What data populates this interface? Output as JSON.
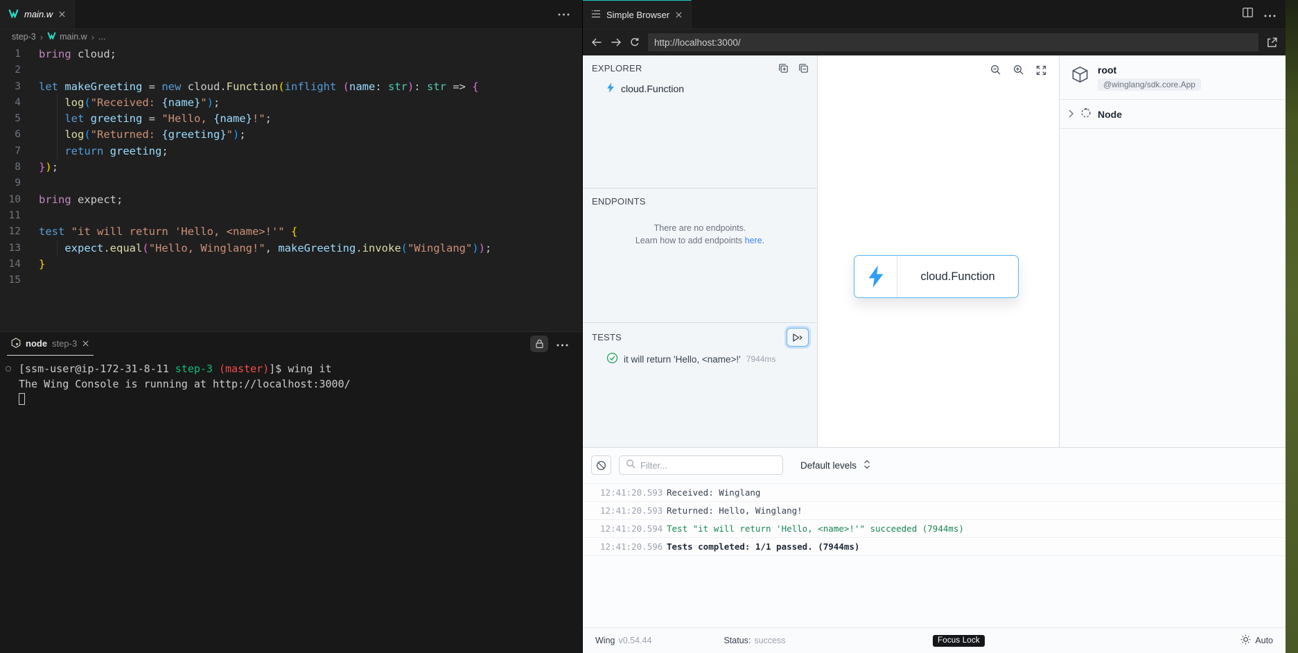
{
  "colors": {
    "wing_teal": "#2bd9c7",
    "accent_blue": "#2f9ff5",
    "success_green": "#22a75d",
    "link_blue": "#3b82f6"
  },
  "editor": {
    "tab_title": "main.w",
    "breadcrumb": {
      "folder": "step-3",
      "file": "main.w",
      "more": "..."
    },
    "code_lines": [
      {
        "n": "1",
        "segs": [
          [
            "imp",
            "bring"
          ],
          [
            "d",
            " cloud;"
          ]
        ]
      },
      {
        "n": "2",
        "segs": []
      },
      {
        "n": "3",
        "segs": [
          [
            "kw",
            "let"
          ],
          [
            "d",
            " "
          ],
          [
            "var",
            "makeGreeting"
          ],
          [
            "d",
            " = "
          ],
          [
            "kw",
            "new"
          ],
          [
            "d",
            " cloud."
          ],
          [
            "fn",
            "Function"
          ],
          [
            "b1",
            "("
          ],
          [
            "kw",
            "inflight"
          ],
          [
            "d",
            " "
          ],
          [
            "b2",
            "("
          ],
          [
            "var",
            "name"
          ],
          [
            "d",
            ": "
          ],
          [
            "type",
            "str"
          ],
          [
            "b2",
            ")"
          ],
          [
            "d",
            ": "
          ],
          [
            "type",
            "str"
          ],
          [
            "d",
            " => "
          ],
          [
            "b2",
            "{"
          ]
        ]
      },
      {
        "n": "4",
        "guide": true,
        "segs": [
          [
            "d",
            "    "
          ],
          [
            "fn",
            "log"
          ],
          [
            "b3",
            "("
          ],
          [
            "str",
            "\"Received: "
          ],
          [
            "var",
            "{name}"
          ],
          [
            "str",
            "\""
          ],
          [
            "b3",
            ")"
          ],
          [
            "d",
            ";"
          ]
        ]
      },
      {
        "n": "5",
        "guide": true,
        "segs": [
          [
            "d",
            "    "
          ],
          [
            "kw",
            "let"
          ],
          [
            "d",
            " "
          ],
          [
            "var",
            "greeting"
          ],
          [
            "d",
            " = "
          ],
          [
            "str",
            "\"Hello, "
          ],
          [
            "var",
            "{name}"
          ],
          [
            "str",
            "!\""
          ],
          [
            "d",
            ";"
          ]
        ]
      },
      {
        "n": "6",
        "guide": true,
        "segs": [
          [
            "d",
            "    "
          ],
          [
            "fn",
            "log"
          ],
          [
            "b3",
            "("
          ],
          [
            "str",
            "\"Returned: "
          ],
          [
            "var",
            "{greeting}"
          ],
          [
            "str",
            "\""
          ],
          [
            "b3",
            ")"
          ],
          [
            "d",
            ";"
          ]
        ]
      },
      {
        "n": "7",
        "guide": true,
        "segs": [
          [
            "d",
            "    "
          ],
          [
            "kw",
            "return"
          ],
          [
            "d",
            " "
          ],
          [
            "var",
            "greeting"
          ],
          [
            "d",
            ";"
          ]
        ]
      },
      {
        "n": "8",
        "segs": [
          [
            "b2",
            "}"
          ],
          [
            "b1",
            ")"
          ],
          [
            "d",
            ";"
          ]
        ]
      },
      {
        "n": "9",
        "segs": []
      },
      {
        "n": "10",
        "segs": [
          [
            "imp",
            "bring"
          ],
          [
            "d",
            " expect;"
          ]
        ]
      },
      {
        "n": "11",
        "segs": []
      },
      {
        "n": "12",
        "segs": [
          [
            "kw",
            "test"
          ],
          [
            "d",
            " "
          ],
          [
            "str",
            "\"it will return 'Hello, <name>!'\""
          ],
          [
            "d",
            " "
          ],
          [
            "b1",
            "{"
          ]
        ]
      },
      {
        "n": "13",
        "guide": true,
        "segs": [
          [
            "d",
            "    "
          ],
          [
            "var",
            "expect"
          ],
          [
            "d",
            "."
          ],
          [
            "fn",
            "equal"
          ],
          [
            "b2",
            "("
          ],
          [
            "str",
            "\"Hello, Winglang!\""
          ],
          [
            "d",
            ", "
          ],
          [
            "var",
            "makeGreeting"
          ],
          [
            "d",
            "."
          ],
          [
            "fn",
            "invoke"
          ],
          [
            "b3",
            "("
          ],
          [
            "str",
            "\"Winglang\""
          ],
          [
            "b3",
            ")"
          ],
          [
            "b2",
            ")"
          ],
          [
            "d",
            ";"
          ]
        ]
      },
      {
        "n": "14",
        "segs": [
          [
            "b1",
            "}"
          ]
        ]
      },
      {
        "n": "15",
        "segs": []
      }
    ]
  },
  "terminal": {
    "tab_name": "node",
    "tab_detail": "step-3",
    "lines": [
      {
        "marker": true,
        "segs": [
          [
            "td",
            "[ssm-user@ip-172-31-8-11 "
          ],
          [
            "tg",
            "step-3"
          ],
          [
            "td",
            " "
          ],
          [
            "tr",
            "(master)"
          ],
          [
            "td",
            "]$ wing it"
          ]
        ]
      },
      {
        "segs": [
          [
            "td",
            "The Wing Console is running at http://localhost:3000/"
          ]
        ]
      },
      {
        "cursor": true,
        "segs": []
      }
    ]
  },
  "browser": {
    "tab_title": "Simple Browser",
    "url": "http://localhost:3000/"
  },
  "console": {
    "explorer": {
      "title": "EXPLORER",
      "item": "cloud.Function"
    },
    "endpoints": {
      "title": "ENDPOINTS",
      "empty_line1": "There are no endpoints.",
      "empty_line2": "Learn how to add endpoints",
      "link": "here."
    },
    "tests": {
      "title": "TESTS",
      "item": "it will return 'Hello, <name>!'",
      "duration": "7944ms"
    },
    "canvas": {
      "node_label": "cloud.Function"
    },
    "inspector": {
      "root_title": "root",
      "root_badge": "@winglang/sdk.core.App",
      "node_label": "Node"
    },
    "logs": {
      "filter_placeholder": "Filter...",
      "levels_label": "Default levels",
      "rows": [
        {
          "time": "12:41:20.593",
          "msg": "Received: Winglang",
          "style": "normal"
        },
        {
          "time": "12:41:20.593",
          "msg": "Returned: Hello, Winglang!",
          "style": "normal"
        },
        {
          "time": "12:41:20.594",
          "msg": "Test \"it will return 'Hello, <name>!'\" succeeded (7944ms)",
          "style": "success"
        },
        {
          "time": "12:41:20.596",
          "msg": "Tests completed: 1/1 passed. (7944ms)",
          "style": "bold"
        }
      ]
    },
    "statusbar": {
      "app": "Wing",
      "version": "v0.54.44",
      "status_label": "Status:",
      "status_value": "success",
      "focus_badge": "Focus Lock",
      "theme_label": "Auto"
    }
  }
}
